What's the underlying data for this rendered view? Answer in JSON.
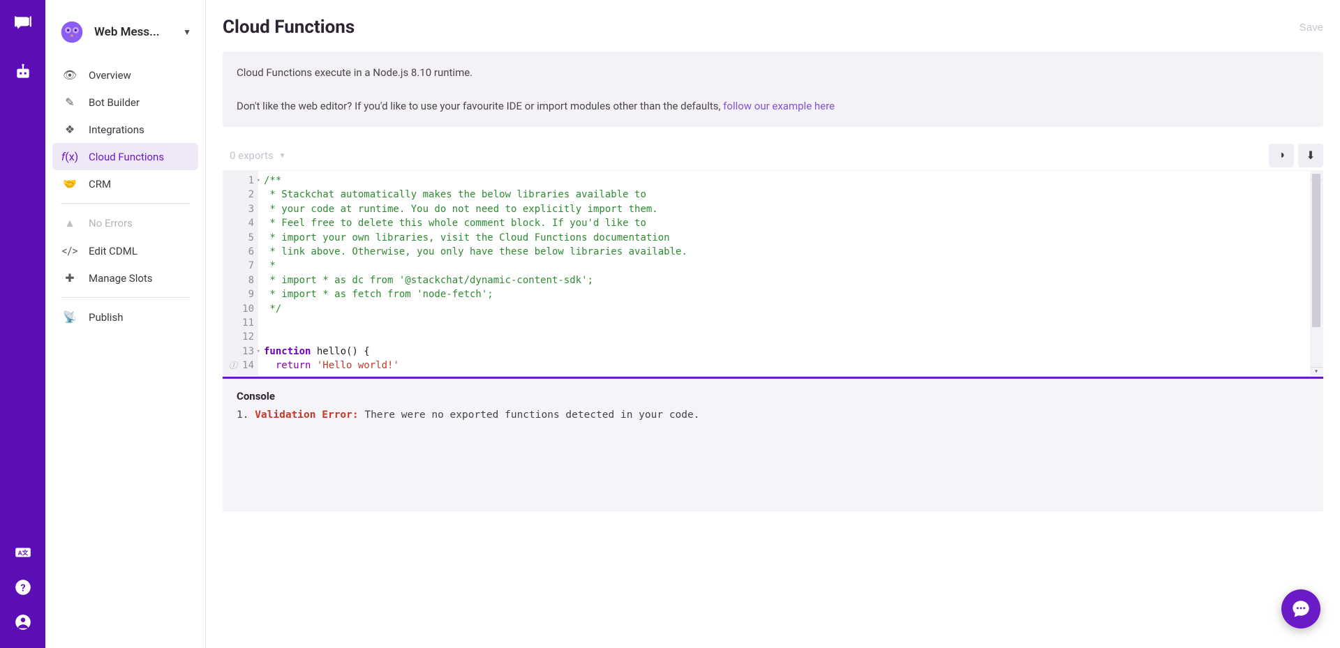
{
  "sidebar": {
    "workspace_name": "Web Mess...",
    "items": [
      {
        "label": "Overview"
      },
      {
        "label": "Bot Builder"
      },
      {
        "label": "Integrations"
      },
      {
        "label": "Cloud Functions"
      },
      {
        "label": "CRM"
      }
    ],
    "errors_label": "No Errors",
    "items2": [
      {
        "label": "Edit CDML"
      },
      {
        "label": "Manage Slots"
      }
    ],
    "publish_label": "Publish"
  },
  "header": {
    "title": "Cloud Functions",
    "save_label": "Save"
  },
  "info": {
    "line1": "Cloud Functions execute in a Node.js 8.10 runtime.",
    "line2a": "Don't like the web editor? If you'd like to use your favourite IDE or import modules other than the defaults, ",
    "link": "follow our example here"
  },
  "toolbar": {
    "exports_label": "0 exports"
  },
  "code": {
    "l1": "/**",
    "l2": " * Stackchat automatically makes the below libraries available to",
    "l3": " * your code at runtime. You do not need to explicitly import them.",
    "l4": " * Feel free to delete this whole comment block. If you'd like to",
    "l5": " * import your own libraries, visit the Cloud Functions documentation",
    "l6": " * link above. Otherwise, you only have these below libraries available.",
    "l7": " *",
    "l8": " * import * as dc from '@stackchat/dynamic-content-sdk';",
    "l9": " * import * as fetch from 'node-fetch';",
    "l10": " */",
    "kw_function": "function",
    "fn_name": " hello() {",
    "kw_return": "return",
    "str_hello": "'Hello world!'"
  },
  "line_numbers": [
    "1",
    "2",
    "3",
    "4",
    "5",
    "6",
    "7",
    "8",
    "9",
    "10",
    "11",
    "12",
    "13",
    "14"
  ],
  "console": {
    "title": "Console",
    "idx": "1. ",
    "err": "Validation Error:",
    "msg": " There were no exported functions detected in your code."
  }
}
